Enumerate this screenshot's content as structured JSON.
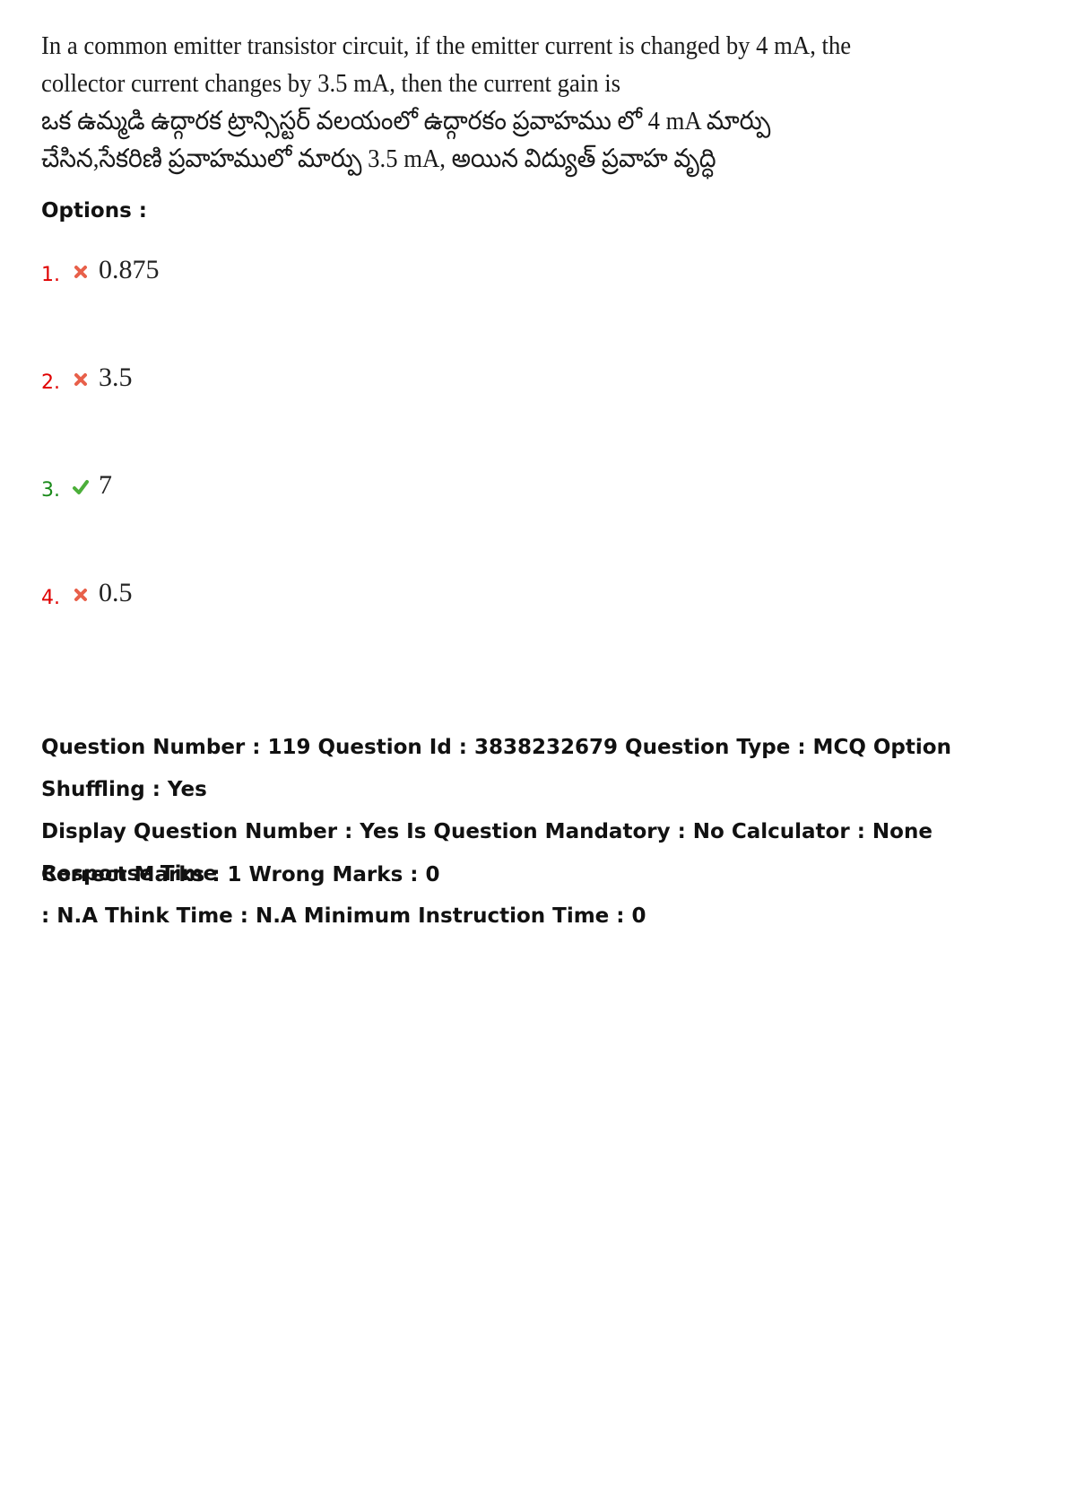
{
  "question": {
    "lines": [
      "In a common emitter transistor circuit, if the emitter current is changed by 4 mA, the",
      "collector current changes by 3.5 mA, then the current gain is",
      "ఒక ఉమ్మడి ఉద్గారక ట్రాన్సిస్టర్ వలయంలో ఉద్గారకం ప్రవాహము లో 4 mA మార్పు",
      "చేసిన,సేకరిణి ప్రవాహములో మార్పు 3.5 mA, అయిన విద్యుత్ ప్రవాహ వృద్ధి"
    ]
  },
  "options_heading": "Options :",
  "options": [
    {
      "number": "1.",
      "value": "0.875",
      "status": "wrong",
      "icon": "cross-icon"
    },
    {
      "number": "2.",
      "value": "3.5",
      "status": "wrong",
      "icon": "cross-icon"
    },
    {
      "number": "3.",
      "value": "7",
      "status": "correct",
      "icon": "check-icon"
    },
    {
      "number": "4.",
      "value": "0.5",
      "status": "wrong",
      "icon": "cross-icon"
    }
  ],
  "meta": {
    "line1": "Question Number : 119 Question Id : 3838232679 Question Type : MCQ Option Shuffling : Yes",
    "line2": "Display Question Number : Yes Is Question Mandatory : No Calculator : None Response Time",
    "line3": ": N.A Think Time : N.A Minimum Instruction Time : 0"
  },
  "marks": "Correct Marks : 1 Wrong Marks : 0",
  "colors": {
    "wrong": "#e00000",
    "correct": "#1a8a1a",
    "cross_icon": "#e8604a",
    "check_icon": "#4caf3a"
  }
}
